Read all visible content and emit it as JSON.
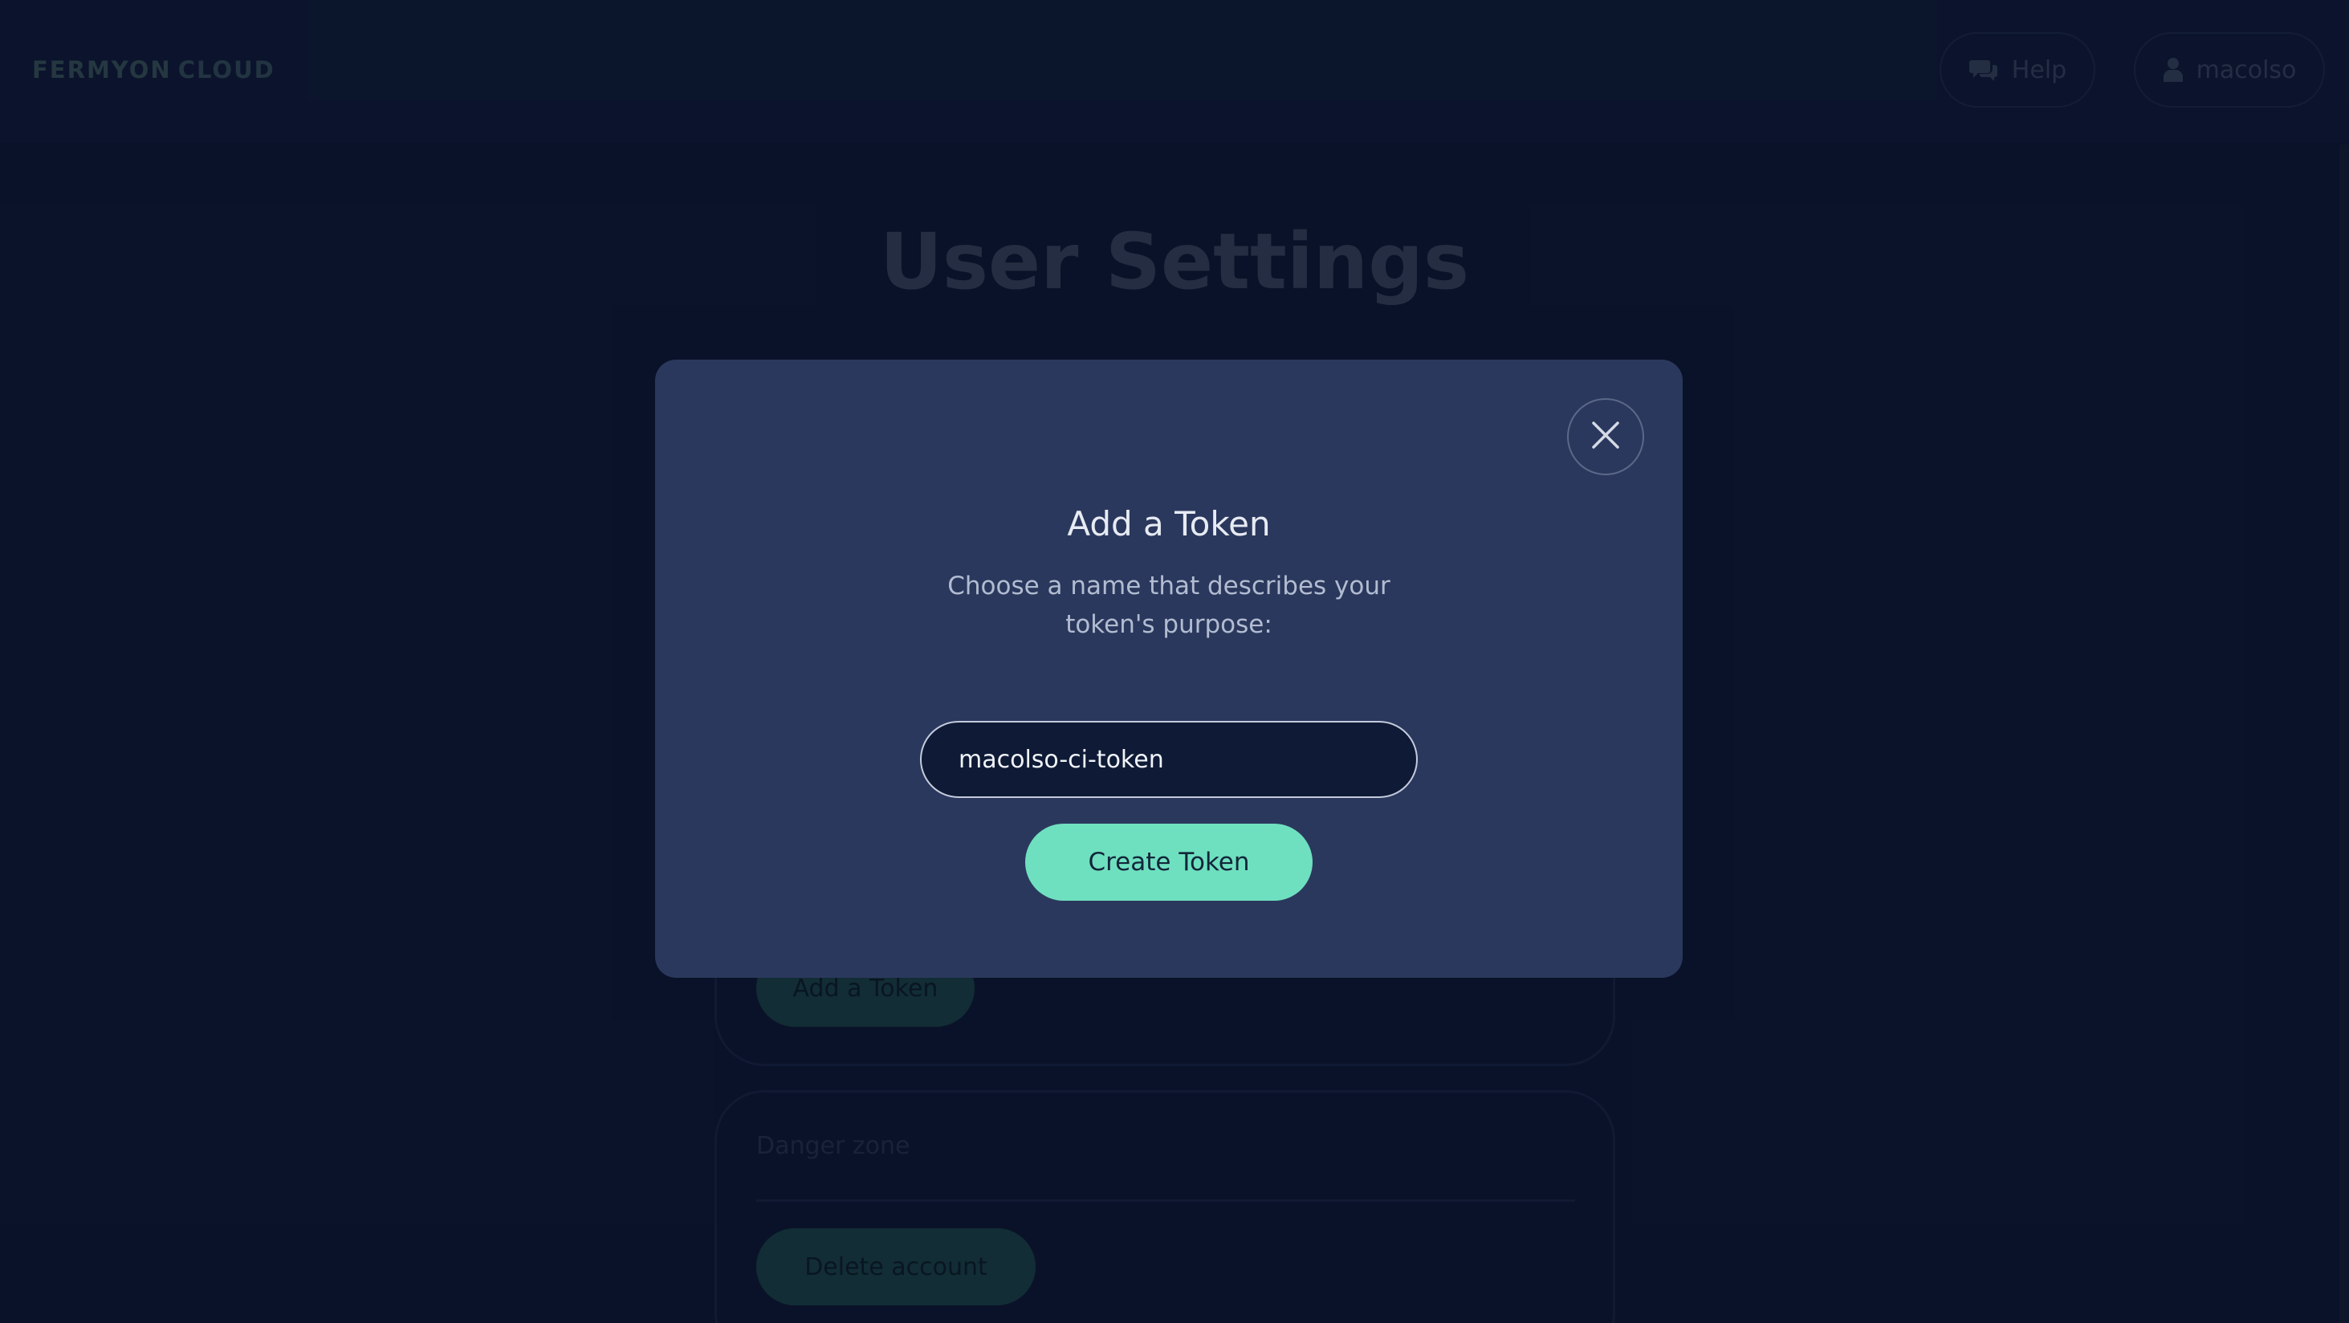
{
  "header": {
    "logo_primary": "FERMYON",
    "logo_secondary": "CLOUD",
    "help_label": "Help",
    "help_icon": "chat-bubbles-icon",
    "user_label": "macolso",
    "user_icon": "person-icon"
  },
  "page": {
    "title": "User Settings"
  },
  "tokens_section": {
    "add_token_label": "Add a Token"
  },
  "danger_section": {
    "heading": "Danger zone",
    "delete_label": "Delete account"
  },
  "modal": {
    "title": "Add a Token",
    "description": "Choose a name that describes your token's purpose:",
    "input_value": "macolso-ci-token",
    "submit_label": "Create Token",
    "close_icon": "close-icon"
  },
  "colors": {
    "background": "#0e1833",
    "modal_background": "#2b385d",
    "accent": "#6fe0bf"
  }
}
